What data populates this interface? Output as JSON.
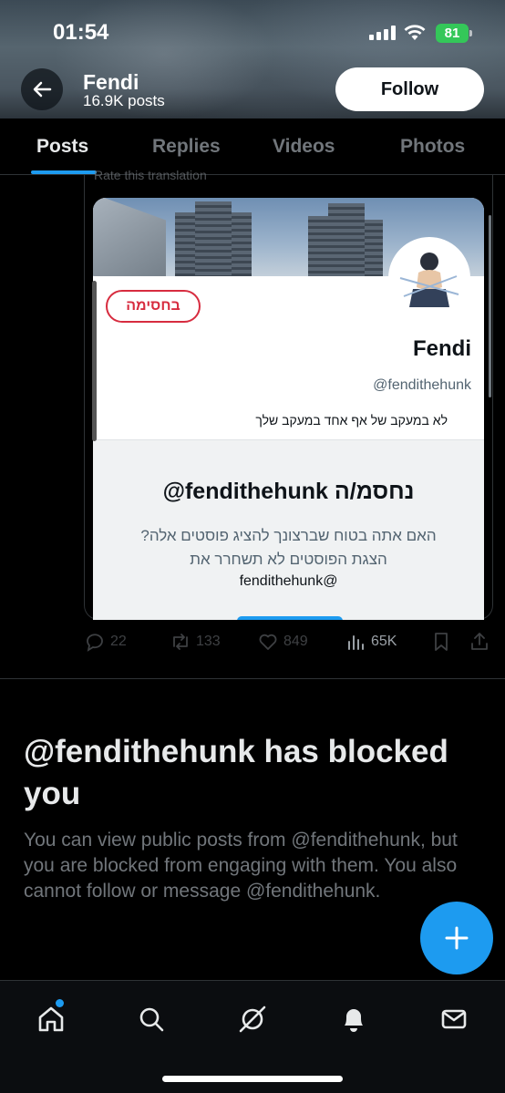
{
  "status_bar": {
    "time": "01:54",
    "battery": "81"
  },
  "header": {
    "name": "Fendi",
    "post_count": "16.9K posts",
    "follow_label": "Follow"
  },
  "tabs": [
    {
      "label": "Posts",
      "active": true
    },
    {
      "label": "Replies",
      "active": false
    },
    {
      "label": "Videos",
      "active": false
    },
    {
      "label": "Photos",
      "active": false
    }
  ],
  "post": {
    "rate_translation": "Rate this translation",
    "embed": {
      "blocked_badge": "בחסימה",
      "name": "Fendi",
      "handle": "@fendithehunk",
      "follow_status": "לא במעקב של אף אחד במעקב שלך",
      "blocked_title": "@fendithehunk נחסמ/ה",
      "blocked_desc": "האם אתה בטוח שברצונך להציג פוסטים אלה? הצגת הפוסטים לא תשחרר את",
      "blocked_desc_handle": "fendithehunk@"
    },
    "actions": {
      "replies": "22",
      "reposts": "133",
      "likes": "849",
      "views": "65K"
    }
  },
  "blocked_notice": {
    "heading": "@fendithehunk has blocked you",
    "body": "You can view public posts from @fendithehunk, but you are blocked from engaging with them. You also cannot follow or message @fendithehunk."
  },
  "colors": {
    "accent": "#1d9bf0",
    "blocked_red": "#d72c3f",
    "battery_green": "#34c759"
  },
  "icons": {
    "nav": [
      "home-icon",
      "search-icon",
      "grok-icon",
      "notifications-icon",
      "messages-icon"
    ],
    "fab": "compose-plus-icon"
  }
}
